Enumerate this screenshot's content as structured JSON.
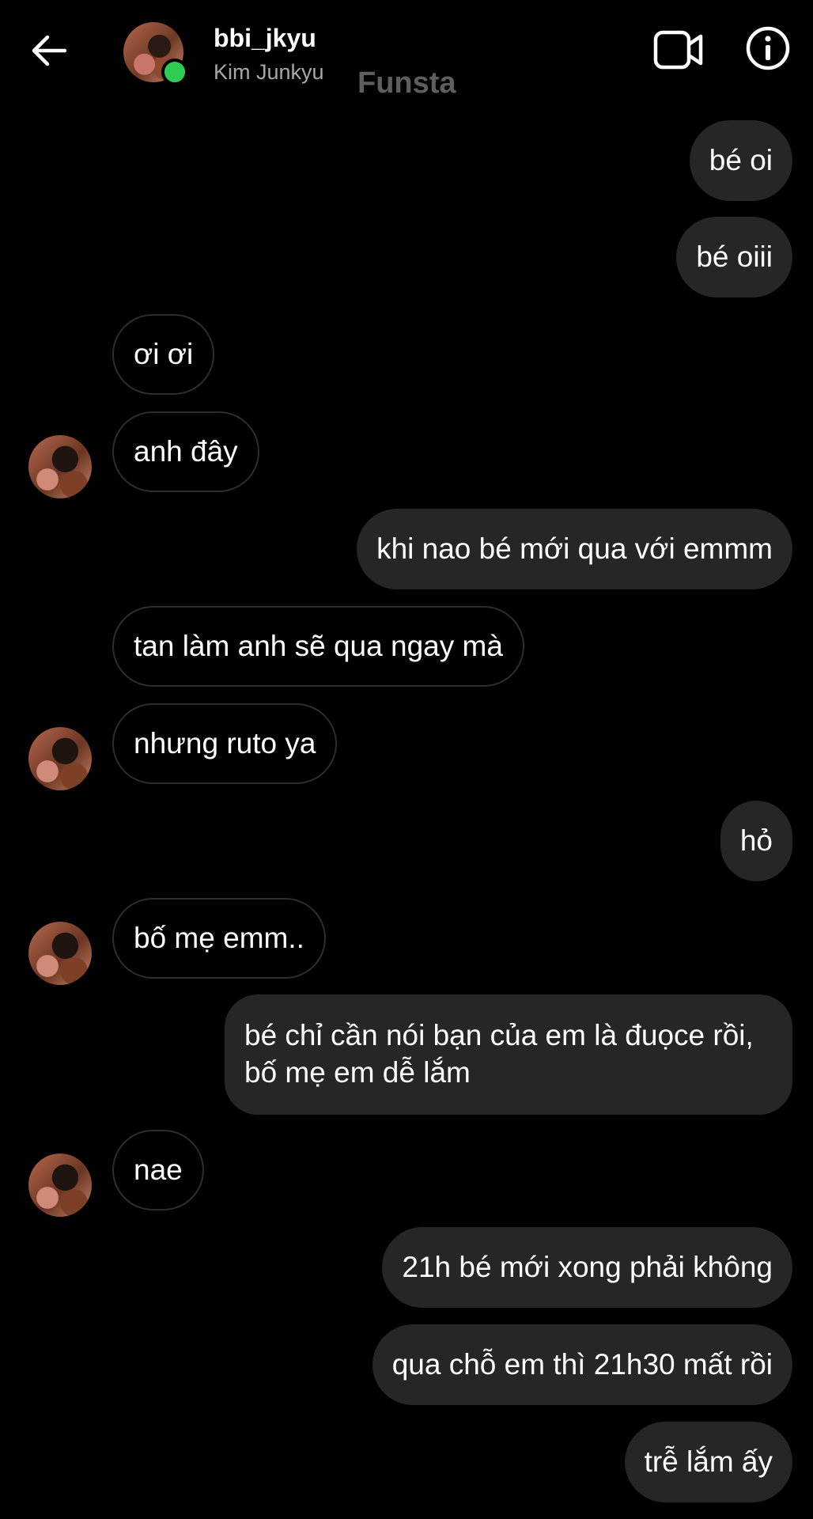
{
  "header": {
    "username": "bbi_jkyu",
    "fullname": "Kim Junkyu",
    "watermark": "Funsta",
    "online_color": "#2ecc52",
    "icons": [
      "back-arrow-icon",
      "video-call-icon",
      "info-icon"
    ]
  },
  "messages": [
    {
      "side": "out",
      "text": "bé oi"
    },
    {
      "side": "out",
      "text": "bé oiii"
    },
    {
      "side": "in",
      "text": "ơi ơi"
    },
    {
      "side": "in",
      "text": "anh đây"
    },
    {
      "side": "out",
      "text": "khi nao bé mới qua với emmm"
    },
    {
      "side": "in",
      "text": "tan làm anh sẽ qua ngay mà"
    },
    {
      "side": "in",
      "text": "nhưng ruto ya"
    },
    {
      "side": "out",
      "text": "hỏ"
    },
    {
      "side": "in",
      "text": "bố mẹ emm.."
    },
    {
      "side": "out",
      "text": "bé chỉ cần nói bạn của em là đuọce rồi, bố mẹ em dễ lắm"
    },
    {
      "side": "in",
      "text": "nae"
    },
    {
      "side": "out",
      "text": "21h bé mới xong phải không"
    },
    {
      "side": "out",
      "text": "qua chỗ em thì 21h30 mất rồi"
    },
    {
      "side": "out",
      "text": "trễ lắm ấy"
    }
  ],
  "colors": {
    "background": "#000000",
    "outgoing_bubble": "#262626",
    "incoming_border": "#2e2e2e",
    "secondary_text": "#a8a8a8"
  }
}
